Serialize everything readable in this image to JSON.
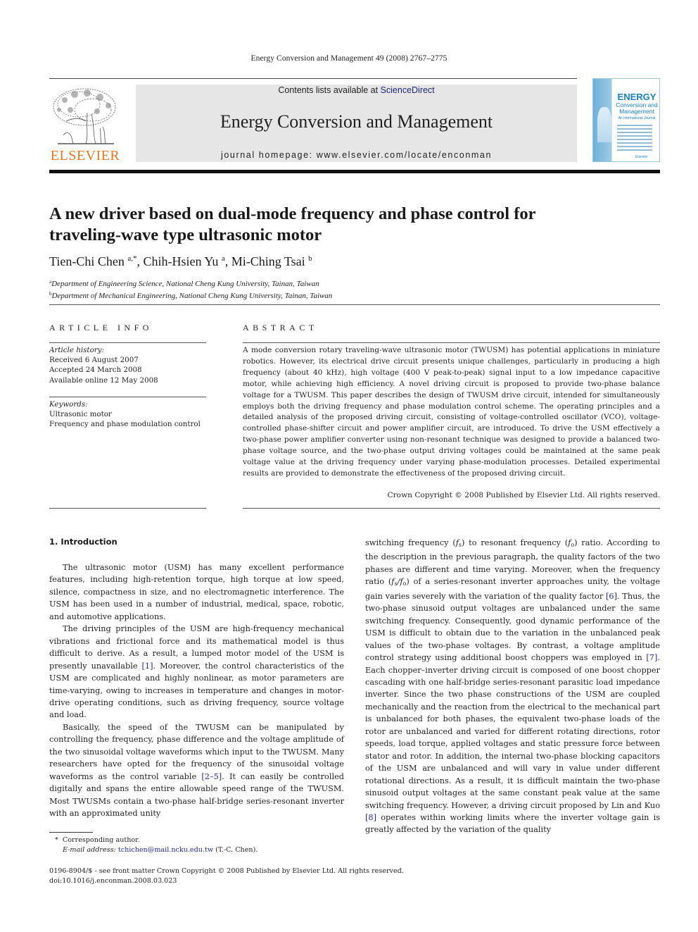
{
  "running_head": "Energy Conversion and Management 49 (2008) 2767–2775",
  "banner": {
    "contents_prefix": "Contents lists available at ",
    "contents_link": "ScienceDirect",
    "journal_name": "Energy Conversion and Management",
    "homepage": "journal homepage: www.elsevier.com/locate/enconman"
  },
  "publisher_logo": {
    "icon": "elsevier-tree-icon",
    "wordmark": "ELSEVIER",
    "color": "#e87722"
  },
  "cover": {
    "title_line1": "ENERGY",
    "title_line2": "Conversion and Management",
    "subtitle": "An International Journal",
    "publisher": "Elsevier",
    "color": "#1a80c4"
  },
  "article": {
    "title": "A new driver based on dual-mode frequency and phase control for traveling-wave type ultrasonic motor",
    "authors": [
      {
        "name": "Tien-Chi Chen",
        "marks": "a,*"
      },
      {
        "name": "Chih-Hsien Yu",
        "marks": "a"
      },
      {
        "name": "Mi-Ching Tsai",
        "marks": "b"
      }
    ],
    "affiliations": [
      {
        "mark": "a",
        "text": "Department of Engineering Science, National Cheng Kung University, Tainan, Taiwan"
      },
      {
        "mark": "b",
        "text": "Department of Mechanical Engineering, National Cheng Kung University, Tainan, Taiwan"
      }
    ]
  },
  "article_info": {
    "heading": "ARTICLE INFO",
    "history_label": "Article history:",
    "history": [
      "Received 6 August 2007",
      "Accepted 24 March 2008",
      "Available online 12 May 2008"
    ],
    "keywords_label": "Keywords:",
    "keywords": [
      "Ultrasonic motor",
      "Frequency and phase modulation control"
    ]
  },
  "abstract": {
    "heading": "ABSTRACT",
    "text": "A mode conversion rotary traveling-wave ultrasonic motor (TWUSM) has potential applications in miniature robotics. However, its electrical drive circuit presents unique challenges, particularly in producing a high frequency (about 40 kHz), high voltage (400 V peak-to-peak) signal input to a low impedance capacitive motor, while achieving high efficiency. A novel driving circuit is proposed to provide two-phase balance voltage for a TWUSM. This paper describes the design of TWUSM drive circuit, intended for simultaneously employs both the driving frequency and phase modulation control scheme. The operating principles and a detailed analysis of the proposed driving circuit, consisting of voltage-controlled oscillator (VCO), voltage-controlled phase-shifter circuit and power amplifier circuit, are introduced. To drive the USM effectively a two-phase power amplifier converter using non-resonant technique was designed to provide a balanced two-phase voltage source, and the two-phase output driving voltages could be maintained at the same peak voltage value at the driving frequency under varying phase-modulation processes. Detailed experimental results are provided to demonstrate the effectiveness of the proposed driving circuit.",
    "copyright": "Crown Copyright © 2008 Published by Elsevier Ltd. All rights reserved."
  },
  "introduction": {
    "heading": "1. Introduction",
    "p1": "The ultrasonic motor (USM) has many excellent performance features, including high-retention torque, high torque at low speed, silence, compactness in size, and no electromagnetic interference. The USM has been used in a number of industrial, medical, space, robotic, and automotive applications.",
    "p2_a": "The driving principles of the USM are high-frequency mechanical vibrations and frictional force and its mathematical model is thus difficult to derive. As a result, a lumped motor model of the USM is presently unavailable ",
    "p2_cite": "[1]",
    "p2_b": ". Moreover, the control characteristics of the USM are complicated and highly nonlinear, as motor parameters are time-varying, owing to increases in temperature and changes in motor-drive operating conditions, such as driving frequency, source voltage and load.",
    "p3_a": "Basically, the speed of the TWUSM can be manipulated by controlling the frequency, phase difference and the voltage amplitude of the two sinusoidal voltage waveforms which input to the TWUSM. Many researchers have opted for the frequency of the sinusoidal voltage waveforms as the control variable ",
    "p3_cite": "[2–5]",
    "p3_b": ". It can easily be controlled digitally and spans the entire allowable speed range of the TWUSM. Most TWUSMs contain a two-phase half-bridge series-resonant inverter with an approximated unity",
    "r1_a": "switching frequency (",
    "r1_fs": "f",
    "r1_fs_sub": "s",
    "r1_b": ") to resonant frequency (",
    "r1_fo": "f",
    "r1_fo_sub": "o",
    "r1_c": ") ratio. According to the description in the previous paragraph, the quality factors of the two phases are different and time varying. Moreover, when the frequency ratio (",
    "r1_ratio": "f",
    "r1_ratio_sub1": "s",
    "r1_ratio_slash": "/f",
    "r1_ratio_sub2": "o",
    "r1_d": ") of a series-resonant inverter approaches unity, the voltage gain varies severely with the variation of the quality factor ",
    "r1_cite6": "[6]",
    "r1_e": ". Thus, the two-phase sinusoid output voltages are unbalanced under the same switching frequency. Consequently, good dynamic performance of the USM is difficult to obtain due to the variation in the unbalanced peak values of the two-phase voltages. By contrast, a voltage amplitude control strategy using additional boost choppers was employed in ",
    "r1_cite7": "[7]",
    "r1_f": ". Each chopper–inverter driving circuit is composed of one boost chopper cascading with one half-bridge series-resonant parasitic load impedance inverter. Since the two phase constructions of the USM are coupled mechanically and the reaction from the electrical to the mechanical part is unbalanced for both phases, the equivalent two-phase loads of the rotor are unbalanced and varied for different rotating directions, rotor speeds, load torque, applied voltages and static pressure force between stator and rotor. In addition, the internal two-phase blocking capacitors of the USM are unbalanced and will vary in value under different rotational directions. As a result, it is difficult maintain the two-phase sinusoid output voltages at the same constant peak value at the same switching frequency. However, a driving circuit proposed by Lin and Kuo ",
    "r1_cite8": "[8]",
    "r1_g": " operates within working limits where the inverter voltage gain is greatly affected by the variation of the quality"
  },
  "footnote": {
    "star": "*",
    "corresponding": "Corresponding author.",
    "email_label": "E-mail address:",
    "email": "tchichen@mail.ncku.edu.tw",
    "email_suffix": " (T.-C. Chen)."
  },
  "front_matter": {
    "issn_line": "0196-8904/$ - see front matter Crown Copyright © 2008 Published by Elsevier Ltd. All rights reserved.",
    "doi": "doi:10.1016/j.enconman.2008.03.023"
  },
  "colors": {
    "link": "#1f2a8a",
    "elsevier_orange": "#e87722",
    "banner_bg": "#e6e6e6"
  }
}
